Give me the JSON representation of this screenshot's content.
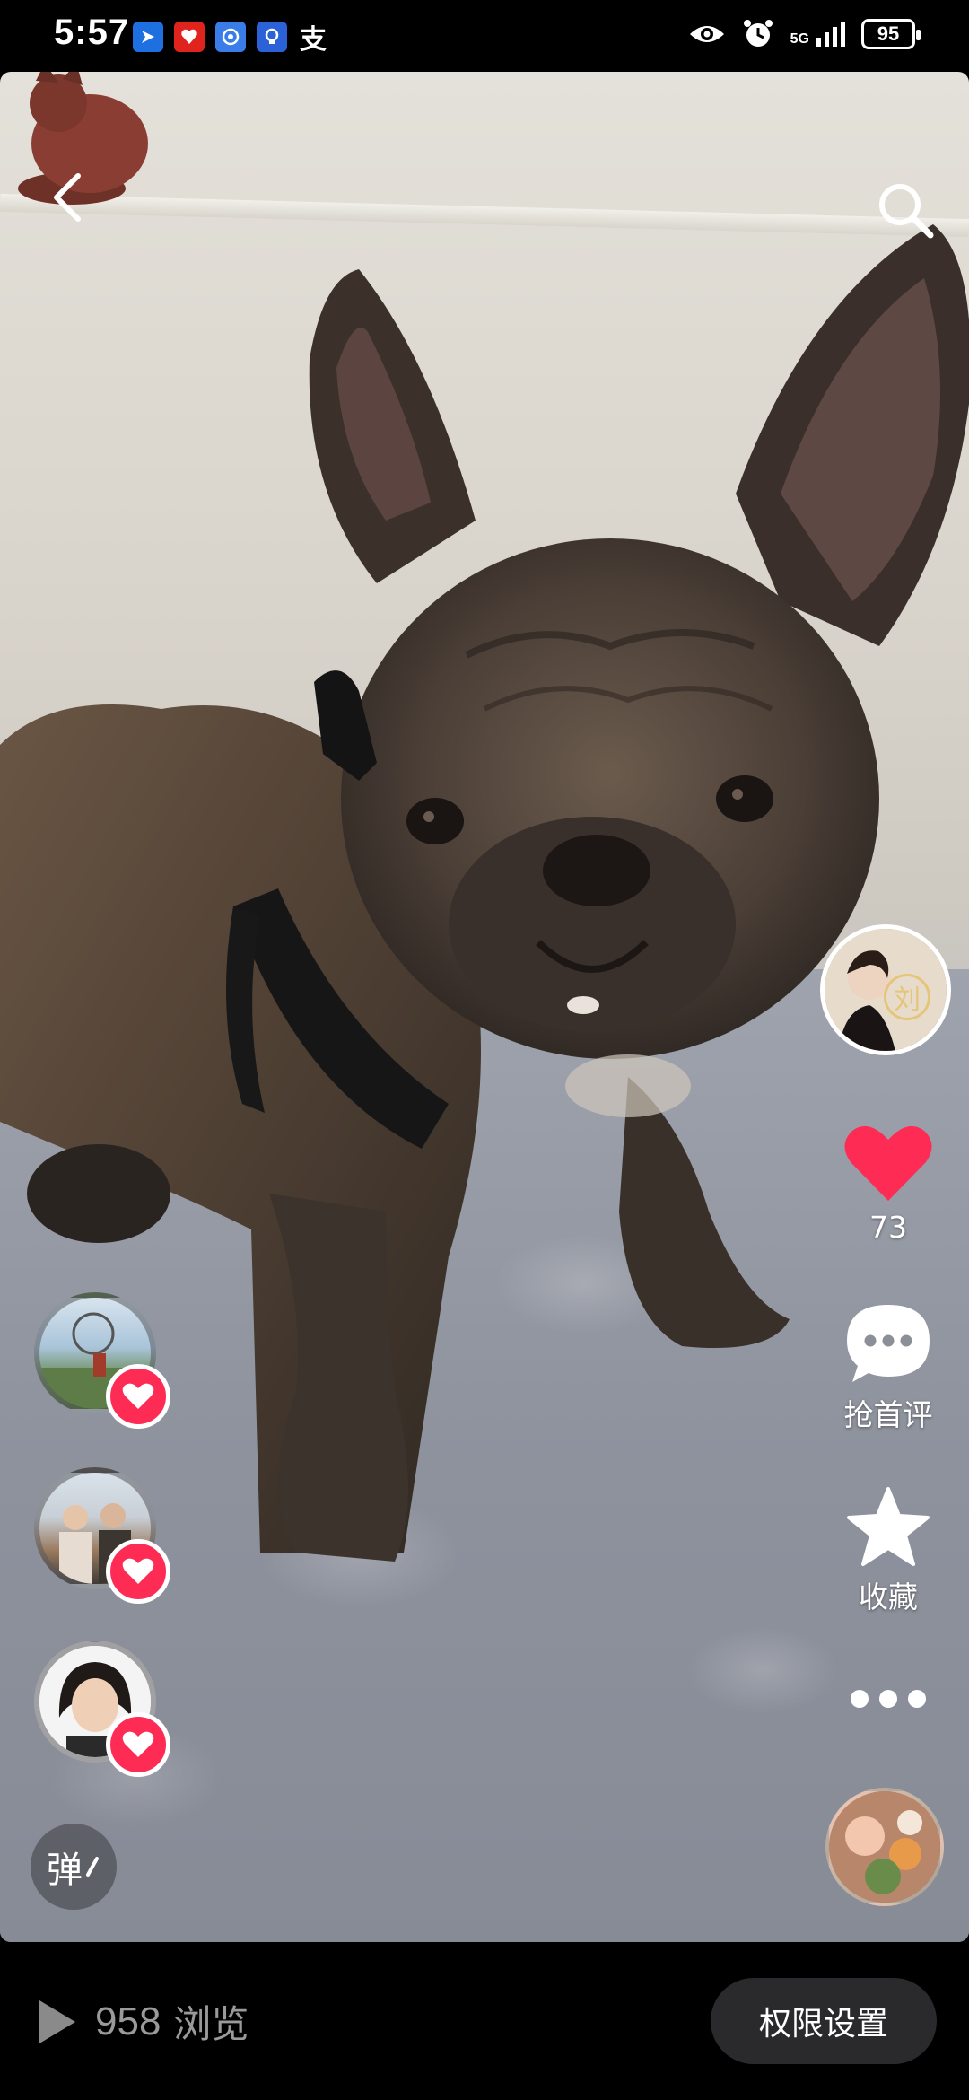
{
  "status_bar": {
    "time": "5:57",
    "battery": "95",
    "network": "5G",
    "app_icons": [
      "blue-arrow-app-icon",
      "red-app-icon",
      "blue-compass-app-icon",
      "bulb-app-icon",
      "alipay-icon"
    ]
  },
  "top_bar": {
    "back_icon": "chevron-left-icon",
    "search_icon": "search-icon"
  },
  "actions": {
    "author_badge": "刘",
    "like_count": "73",
    "comment_label": "抢首评",
    "favorite_label": "收藏",
    "more_icon": "more-dots-icon"
  },
  "likers": [
    {
      "name": "liker-1"
    },
    {
      "name": "liker-2"
    },
    {
      "name": "liker-3"
    }
  ],
  "danmaku": {
    "label": "弹"
  },
  "bottom_bar": {
    "views_count": "958",
    "views_label": "浏览",
    "permission_button": "权限设置"
  },
  "colors": {
    "like_red": "#fe2c55",
    "background": "#000000",
    "white": "#ffffff"
  }
}
